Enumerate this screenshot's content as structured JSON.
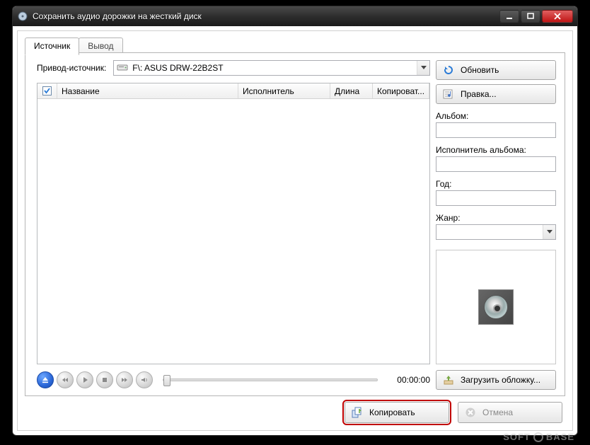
{
  "window": {
    "title": "Сохранить аудио дорожки на жесткий диск"
  },
  "tabs": {
    "source": "Источник",
    "output": "Вывод"
  },
  "source_row": {
    "label": "Привод-источник:",
    "drive_value": "F\\: ASUS    DRW-22B2ST"
  },
  "buttons": {
    "refresh": "Обновить",
    "edit": "Правка...",
    "load_cover": "Загрузить обложку...",
    "copy": "Копировать",
    "cancel": "Отмена"
  },
  "fields": {
    "album_label": "Альбом:",
    "album_value": "",
    "album_artist_label": "Исполнитель альбома:",
    "album_artist_value": "",
    "year_label": "Год:",
    "year_value": "",
    "genre_label": "Жанр:",
    "genre_value": ""
  },
  "columns": {
    "name": "Название",
    "artist": "Исполнитель",
    "length": "Длина",
    "copy": "Копироват..."
  },
  "player": {
    "time": "00:00:00"
  },
  "watermark": {
    "left": "SOFT",
    "right": "BASE"
  }
}
